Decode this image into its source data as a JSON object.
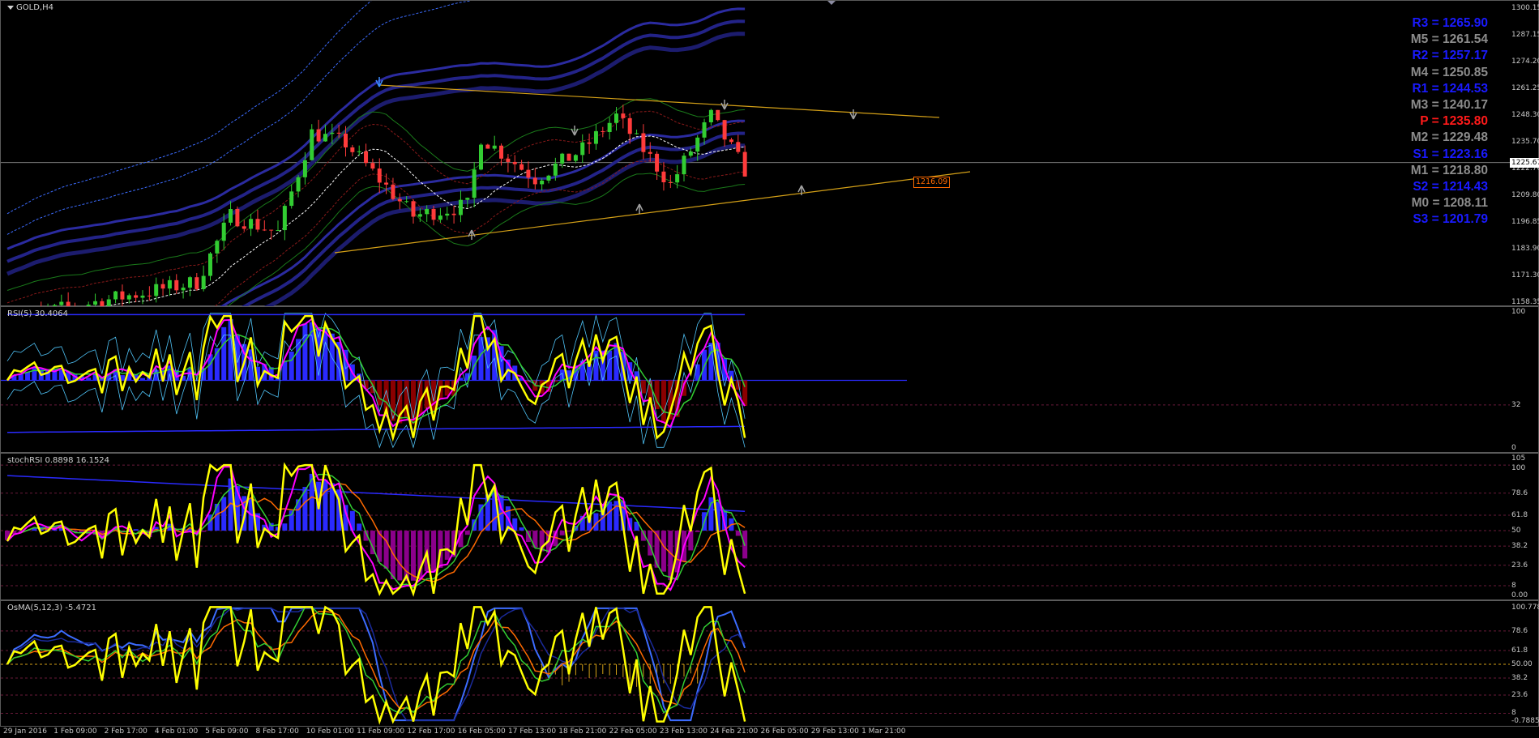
{
  "window": {
    "symbol_title": "GOLD,H4"
  },
  "main_chart": {
    "y_ticks": [
      "1300.15",
      "1287.15",
      "1274.20",
      "1261.25",
      "1248.30",
      "1235.70",
      "1222.70",
      "1209.80",
      "1196.85",
      "1183.90",
      "1171.30",
      "1158.35"
    ],
    "current_price": "1225.67",
    "trendline_tag": "1216.09",
    "pivot_levels": [
      {
        "label": "R3 = 1265.90",
        "color": "#1a1aff"
      },
      {
        "label": "M5 = 1261.54",
        "color": "#8c8c8c"
      },
      {
        "label": "R2 = 1257.17",
        "color": "#1a1aff"
      },
      {
        "label": "M4 = 1250.85",
        "color": "#8c8c8c"
      },
      {
        "label": "R1 = 1244.53",
        "color": "#1a1aff"
      },
      {
        "label": "M3 = 1240.17",
        "color": "#8c8c8c"
      },
      {
        "label": "P   = 1235.80",
        "color": "#ff1a1a"
      },
      {
        "label": "M2 = 1229.48",
        "color": "#8c8c8c"
      },
      {
        "label": "S1 = 1223.16",
        "color": "#1a1aff"
      },
      {
        "label": "M1 = 1218.80",
        "color": "#8c8c8c"
      },
      {
        "label": "S2 = 1214.43",
        "color": "#1a1aff"
      },
      {
        "label": "M0 = 1208.11",
        "color": "#8c8c8c"
      },
      {
        "label": "S3 = 1201.79",
        "color": "#1a1aff"
      }
    ]
  },
  "rsi_pane": {
    "label": "RSI(5) 30.4064",
    "y_ticks": [
      "100",
      "32",
      "0"
    ]
  },
  "stoch_pane": {
    "label": "stochRSI 0.8898 16.1524",
    "y_ticks": [
      "105",
      "100",
      "78.6",
      "61.8",
      "50",
      "38.2",
      "23.6",
      "8",
      "0.00"
    ]
  },
  "osma_pane": {
    "label": "OsMA(5,12,3) -5.4721",
    "y_ticks": [
      "100.778",
      "78.6",
      "61.8",
      "50.00",
      "38.2",
      "23.6",
      "8",
      "-0.7885"
    ]
  },
  "x_axis": {
    "ticks": [
      "29 Jan 2016",
      "1 Feb 09:00",
      "2 Feb 17:00",
      "4 Feb 01:00",
      "5 Feb 09:00",
      "8 Feb 17:00",
      "10 Feb 01:00",
      "11 Feb 09:00",
      "12 Feb 17:00",
      "16 Feb 05:00",
      "17 Feb 13:00",
      "18 Feb 21:00",
      "22 Feb 05:00",
      "23 Feb 13:00",
      "24 Feb 21:00",
      "26 Feb 05:00",
      "29 Feb 13:00",
      "1 Mar 21:00"
    ]
  },
  "colors": {
    "bull": "#32cd32",
    "bear": "#ff3b3b",
    "hist_blue": "#2a2aff",
    "hist_red": "#8b0000",
    "hist_purple": "#8b008b",
    "trendline": "#d4a017",
    "yellow": "#ffff00"
  }
}
